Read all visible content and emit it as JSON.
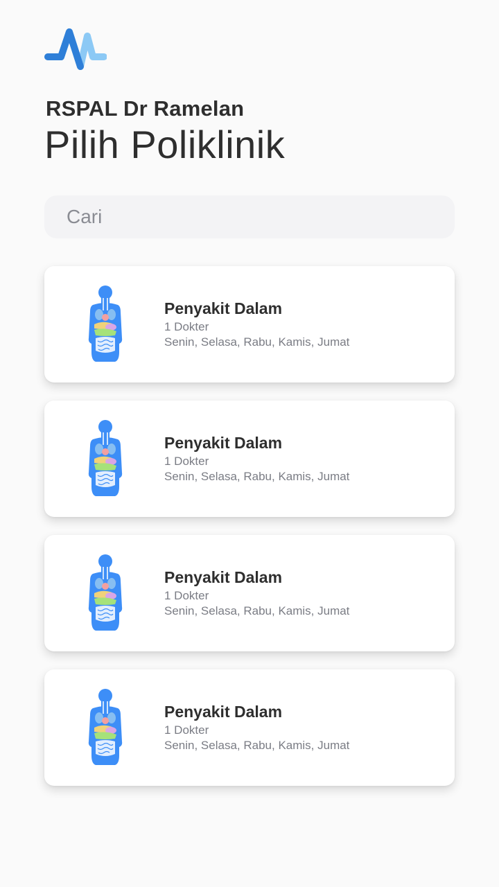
{
  "app": {
    "logo_icon": "heartbeat-logo-icon",
    "hospital_name": "RSPAL Dr Ramelan",
    "page_title": "Pilih Poliklinik"
  },
  "search": {
    "placeholder": "Cari",
    "value": ""
  },
  "clinics": [
    {
      "name": "Penyakit Dalam",
      "doctors": "1 Dokter",
      "days": "Senin, Selasa, Rabu, Kamis, Jumat",
      "icon": "human-body-organs-icon"
    },
    {
      "name": "Penyakit Dalam",
      "doctors": "1 Dokter",
      "days": "Senin, Selasa, Rabu, Kamis, Jumat",
      "icon": "human-body-organs-icon"
    },
    {
      "name": "Penyakit Dalam",
      "doctors": "1 Dokter",
      "days": "Senin, Selasa, Rabu, Kamis, Jumat",
      "icon": "human-body-organs-icon"
    },
    {
      "name": "Penyakit Dalam",
      "doctors": "1 Dokter",
      "days": "Senin, Selasa, Rabu, Kamis, Jumat",
      "icon": "human-body-organs-icon"
    }
  ],
  "colors": {
    "background": "#fafafa",
    "text_primary": "#2e2e2e",
    "text_secondary": "#7a7c84",
    "search_bg": "#f3f3f5",
    "body_icon_blue": "#3d8ef7",
    "logo_dark_blue": "#2f7fd8",
    "logo_light_blue": "#8cc9f5"
  }
}
